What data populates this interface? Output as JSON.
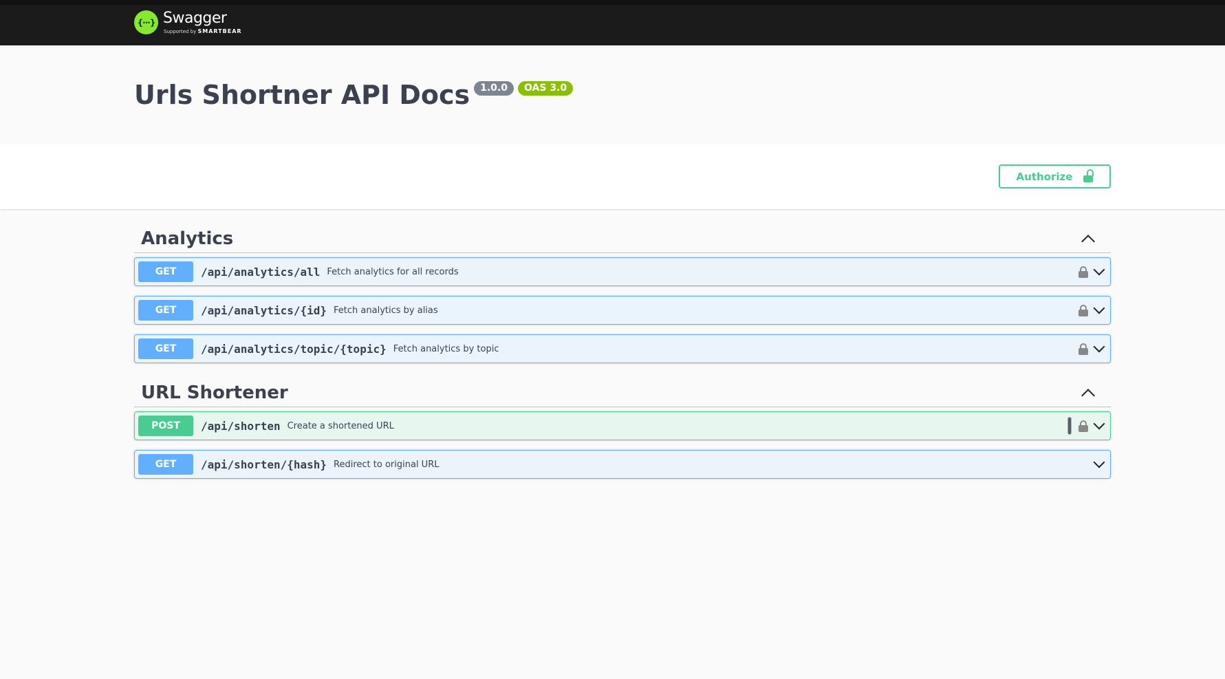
{
  "topbar": {
    "logo_mark": "{···}",
    "logo_name": "Swagger",
    "logo_sub_prefix": "Supported by ",
    "logo_sub_brand": "SMARTBEAR"
  },
  "info": {
    "title": "Urls Shortner API Docs",
    "version_badge": "1.0.0",
    "oas_badge": "OAS 3.0"
  },
  "scheme": {
    "authorize_label": "Authorize"
  },
  "sections": [
    {
      "title": "Analytics",
      "operations": [
        {
          "method": "GET",
          "path": "/api/analytics/all",
          "summary": "Fetch analytics for all records"
        },
        {
          "method": "GET",
          "path": "/api/analytics/{id}",
          "summary": "Fetch analytics by alias"
        },
        {
          "method": "GET",
          "path": "/api/analytics/topic/{topic}",
          "summary": "Fetch analytics by topic"
        }
      ]
    },
    {
      "title": "URL Shortener",
      "operations": [
        {
          "method": "POST",
          "path": "/api/shorten",
          "summary": "Create a shortened URL"
        },
        {
          "method": "GET",
          "path": "/api/shorten/{hash}",
          "summary": "Redirect to original URL"
        }
      ]
    }
  ],
  "colors": {
    "get": "#61affe",
    "post": "#49cc90",
    "topbar": "#1b1b1b",
    "logo_green": "#85ea2d"
  }
}
